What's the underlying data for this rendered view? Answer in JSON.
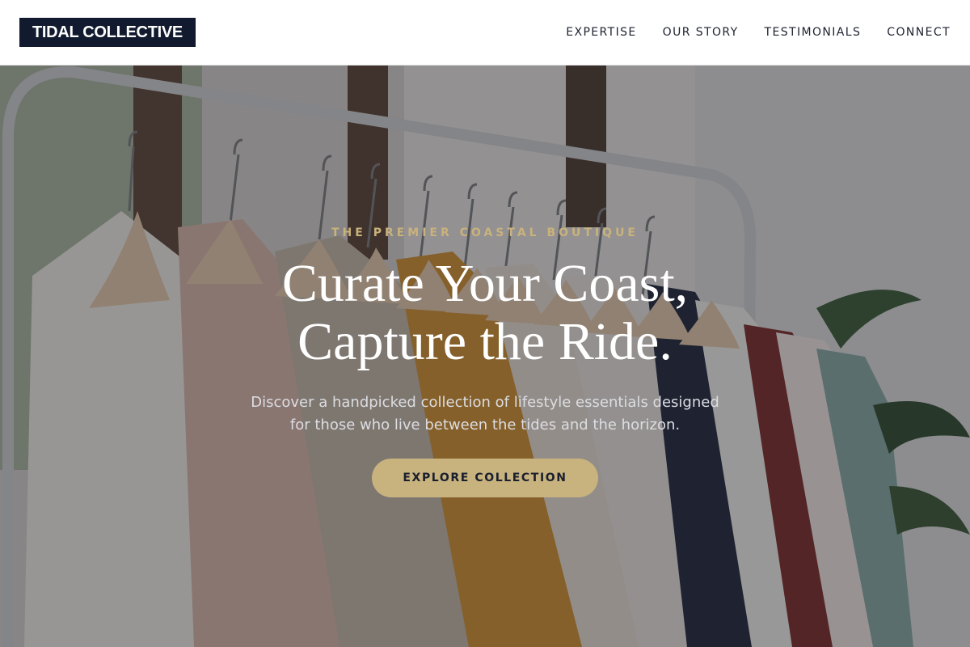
{
  "header": {
    "logo_text": "TIDAL COLLECTIVE",
    "nav": [
      {
        "label": "EXPERTISE"
      },
      {
        "label": "OUR STORY"
      },
      {
        "label": "TESTIMONIALS"
      },
      {
        "label": "CONNECT"
      }
    ]
  },
  "hero": {
    "eyebrow": "THE PREMIER COASTAL BOUTIQUE",
    "headline_line1": "Curate Your Coast,",
    "headline_line2": "Capture the Ride.",
    "subtext_line1": "Discover a handpicked collection of lifestyle essentials designed",
    "subtext_line2": "for those who live between the tides and the horizon.",
    "cta_label": "EXPLORE COLLECTION",
    "background_image": "clothing-rack-photo"
  },
  "colors": {
    "logo_bg": "#111a2e",
    "accent_gold": "#c8b27e",
    "eyebrow_gold": "#c9b27c",
    "overlay": "rgba(28,30,40,0.42)"
  }
}
